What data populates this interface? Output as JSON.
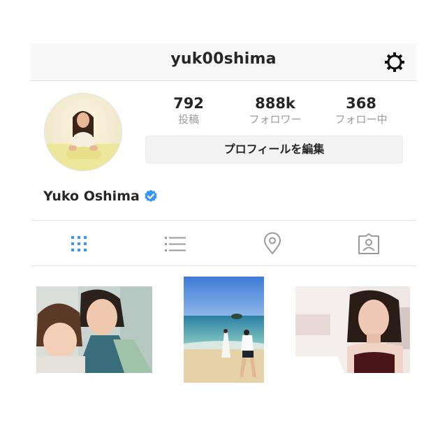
{
  "header": {
    "username": "yuk00shima",
    "settings_icon": "gear-icon"
  },
  "profile": {
    "display_name": "Yuko Oshima",
    "verified": true,
    "edit_button_label": "プロフィールを編集"
  },
  "stats": [
    {
      "value": "792",
      "label": "投稿"
    },
    {
      "value": "888k",
      "label": "フォロワー"
    },
    {
      "value": "368",
      "label": "フォロー中"
    }
  ],
  "tabs": [
    {
      "name": "grid-icon",
      "active": true
    },
    {
      "name": "list-icon",
      "active": false
    },
    {
      "name": "location-pin-icon",
      "active": false
    },
    {
      "name": "tagged-user-icon",
      "active": false
    }
  ],
  "colors": {
    "accent": "#3897f0",
    "verified_badge": "#3897f0",
    "inactive_icon": "#999999"
  }
}
